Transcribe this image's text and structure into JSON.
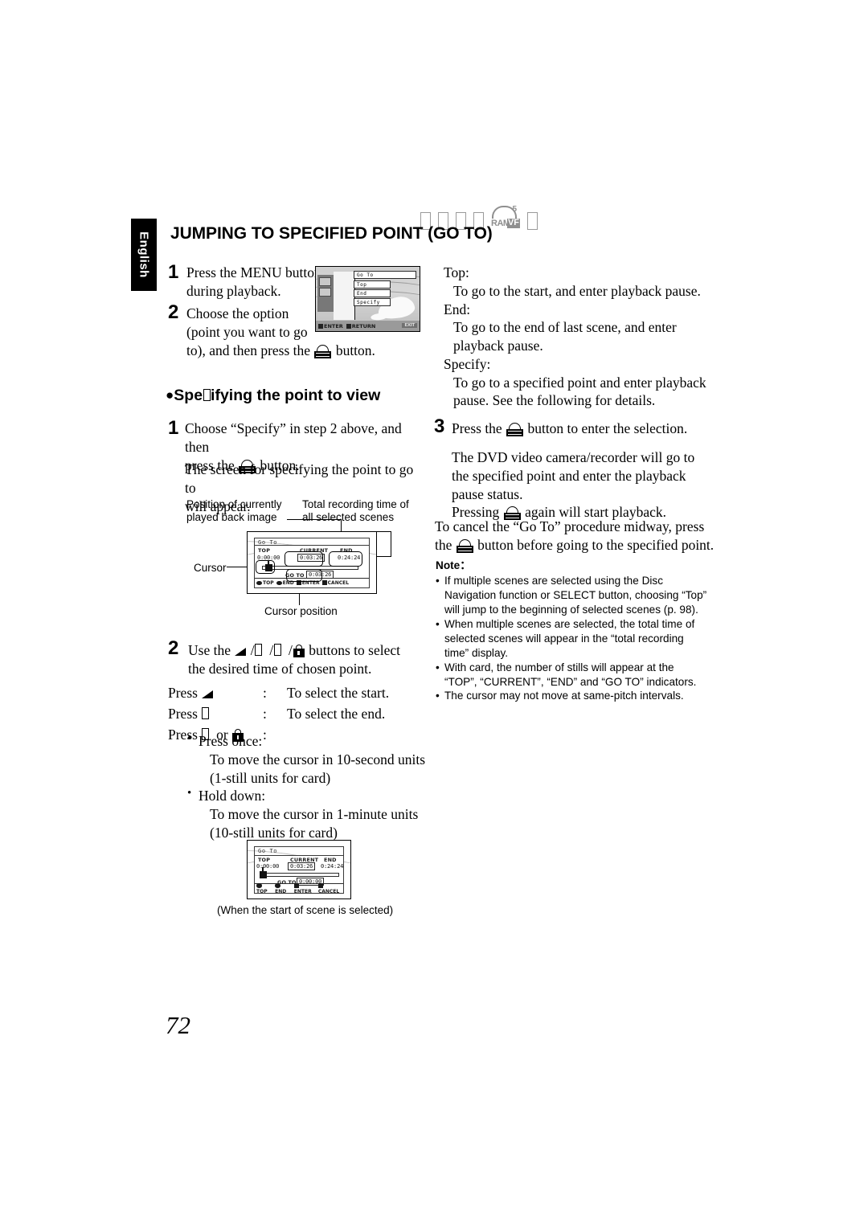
{
  "language_tab": "English",
  "header": {
    "title": "JUMPING TO SPECIFIED POINT (GO TO)",
    "icon_row": {
      "tofu_count": 4,
      "media_icon": {
        "sup": "5",
        "ram": "RAM",
        "vf": "VF"
      },
      "trailing_tofu_count": 1
    }
  },
  "steps": {
    "step1_num": "1",
    "step1_line1": "Press the MENU button",
    "step1_line2": "during playback.",
    "step2_num": "2",
    "step2_line1": "Choose the option",
    "step2_line2": "(point you want to go",
    "step2_line3_a": "to), and then press the",
    "step2_line3_b": "button."
  },
  "options": {
    "top_label": "Top:",
    "top_desc": "To go to the start, and enter playback pause.",
    "end_label": "End:",
    "end_desc_l1": "To go to the end of last scene, and enter",
    "end_desc_l2": "playback pause.",
    "specify_label": "Specify:",
    "specify_desc_l1": "To go to a specified point and enter playback",
    "specify_desc_l2": "pause. See the following for details."
  },
  "subsection": {
    "title_a": "Spe",
    "title_b": "ifying the point to view",
    "s1_num": "1",
    "s1_line1": "Choose “Specify” in step 2 above, and then",
    "s1_line2_a": "press the",
    "s1_line2_b": "button.",
    "s1_para_l1": "The screen for specifying the point to go to",
    "s1_para_l2": "will appear.",
    "s2_num": "2",
    "s2_line1_a": "Use the",
    "s2_line1_b": "buttons to select",
    "s2_line2": "the desired time of chosen point.",
    "press_rows": [
      {
        "label": "Press",
        "colon": ":",
        "desc": "To select the start."
      },
      {
        "label": "Press",
        "colon": ":",
        "desc": "To select the end."
      },
      {
        "label": "Press",
        "mid": "or",
        "colon": ":",
        "desc": ""
      }
    ],
    "press_once_head": "Press once:",
    "press_once_l1": "To move the cursor in 10-second units",
    "press_once_l2": "(1-still units for card)",
    "hold_down_head": "Hold down:",
    "hold_down_l1": "To move the cursor in 1-minute units",
    "hold_down_l2": "(10-still units for card)",
    "s3_num": "3",
    "s3_line1_a": "Press the",
    "s3_line1_b": "button to enter the selection.",
    "s3_para_l1": "The DVD video camera/recorder will go to",
    "s3_para_l2": "the specified point and enter the playback",
    "s3_para_l3": "pause status.",
    "s3_para_l4_a": "Pressing",
    "s3_para_l4_b": "again will start playback.",
    "cancel_l1": "To cancel the “Go To” procedure midway, press",
    "cancel_l2_a": "the",
    "cancel_l2_b": "button before going to the specified point."
  },
  "note": {
    "heading": "Note：",
    "items": [
      "If multiple scenes are selected using the Disc Navigation function or SELECT button, choosing “Top” will jump to the beginning of selected scenes (p. 98).",
      "When multiple scenes are selected, the total time of selected scenes will appear in the “total recording time” display.",
      "With card, the number of stills will appear at the “TOP”, “CURRENT”, “END” and “GO TO” indicators.",
      "The cursor may not move at same-pitch intervals."
    ]
  },
  "screen_menu": {
    "title": "Go To",
    "items": [
      "Top",
      "End",
      "Specify"
    ],
    "bottom_bar": {
      "enter": "ENTER",
      "return": "RETURN",
      "tag": "EXIT"
    }
  },
  "screen_goto_1": {
    "title": "Go To",
    "top_label": "TOP",
    "top_value": "0:00:00",
    "current_label": "CURRENT",
    "current_value": "0:03:26",
    "end_label": "END",
    "end_value": "0:24:24",
    "goto_label": "GO TO",
    "goto_value": "0:03:26",
    "bottom_bar": {
      "top": "TOP",
      "end": "END",
      "enter": "ENTER",
      "cancel": "CANCEL"
    }
  },
  "screen_goto_2": {
    "title": "Go To",
    "top_label": "TOP",
    "top_value": "0:00:00",
    "current_label": "CURRENT",
    "current_value": "0:03:26",
    "end_label": "END",
    "end_value": "0:24:24",
    "goto_label": "GO TO",
    "goto_value": "0:00:00",
    "bottom_bar": {
      "top": "TOP",
      "end": "END",
      "enter": "ENTER",
      "cancel": "CANCEL"
    },
    "caption": "(When the start of scene is selected)"
  },
  "callouts": {
    "position_l1": "Position of currently",
    "position_l2": "played back image",
    "total_l1": "Total recording time of",
    "total_l2": "all selected scenes",
    "cursor": "Cursor",
    "cursor_position": "Cursor position"
  },
  "page_number": "72"
}
